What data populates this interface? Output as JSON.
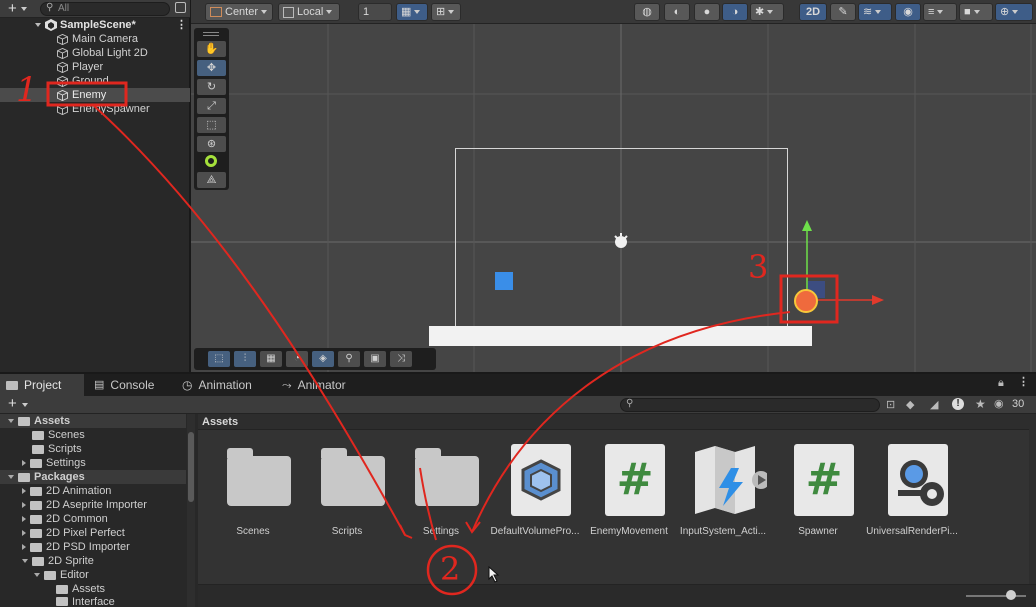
{
  "hierarchy": {
    "search_placeholder": "All",
    "scene_name": "SampleScene*",
    "items": [
      "Main Camera",
      "Global Light 2D",
      "Player",
      "Ground",
      "Enemy",
      "EnemySpawner"
    ]
  },
  "scene_toolbar": {
    "pivot": "Center",
    "space": "Local",
    "grid_value": "1",
    "mode_2d": "2D"
  },
  "tabs": [
    "Project",
    "Console",
    "Animation",
    "Animator"
  ],
  "project_toolbar": {
    "visible_count": "30"
  },
  "tree": [
    {
      "label": "Assets",
      "level": 0,
      "expanded": true,
      "bold": true
    },
    {
      "label": "Scenes",
      "level": 1
    },
    {
      "label": "Scripts",
      "level": 1
    },
    {
      "label": "Settings",
      "level": 1,
      "collapsed": true
    },
    {
      "label": "Packages",
      "level": 0,
      "expanded": true,
      "bold": true
    },
    {
      "label": "2D Animation",
      "level": 1,
      "collapsed": true
    },
    {
      "label": "2D Aseprite Importer",
      "level": 1,
      "collapsed": true
    },
    {
      "label": "2D Common",
      "level": 1,
      "collapsed": true
    },
    {
      "label": "2D Pixel Perfect",
      "level": 1,
      "collapsed": true
    },
    {
      "label": "2D PSD Importer",
      "level": 1,
      "collapsed": true
    },
    {
      "label": "2D Sprite",
      "level": 1,
      "expanded": true
    },
    {
      "label": "Editor",
      "level": 2,
      "expanded": true
    },
    {
      "label": "Assets",
      "level": 3
    },
    {
      "label": "Interface",
      "level": 3
    }
  ],
  "assets_header": "Assets",
  "assets": [
    "Scenes",
    "Scripts",
    "Settings",
    "DefaultVolumePro...",
    "EnemyMovement",
    "InputSystem_Acti...",
    "Spawner",
    "UniversalRenderPi..."
  ],
  "annotations": {
    "n1": "1",
    "n2": "2",
    "n3": "3"
  },
  "colors": {
    "annotation": "#e0271f",
    "selection": "#3f5f8f",
    "accent_blue": "#3e5d88"
  }
}
